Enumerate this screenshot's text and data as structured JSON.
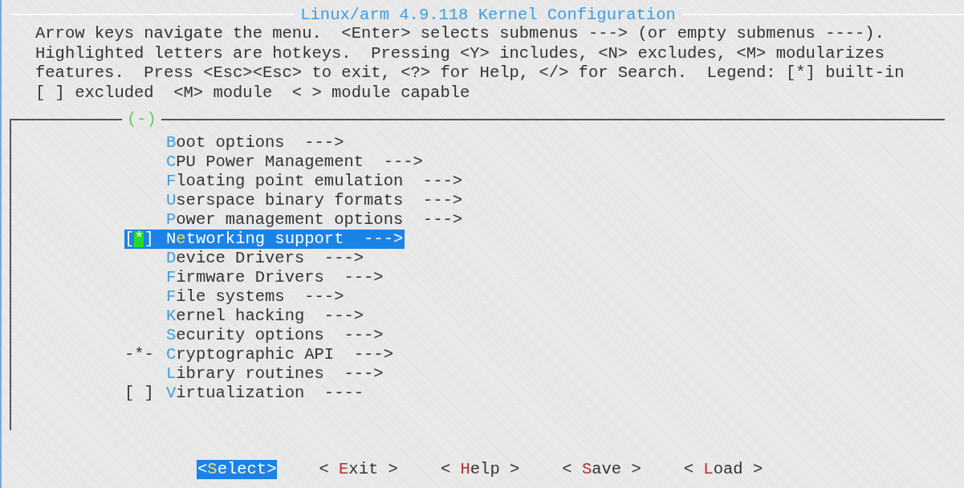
{
  "window": {
    "title": "Linux/arm 4.9.118 Kernel Configuration"
  },
  "help_lines": [
    "Arrow keys navigate the menu.  <Enter> selects submenus ---> (or empty submenus ----).",
    "Highlighted letters are hotkeys.  Pressing <Y> includes, <N> excludes, <M> modularizes",
    "features.  Press <Esc><Esc> to exit, <?> for Help, </> for Search.  Legend: [*] built-in",
    "[ ] excluded  <M> module  < > module capable"
  ],
  "menu": {
    "scroll_indicator": "(-)",
    "items": [
      {
        "hotkey": "B",
        "rest": "oot options",
        "suffix": "--->",
        "selected": false
      },
      {
        "hotkey": "C",
        "rest": "PU Power Management",
        "suffix": "--->",
        "selected": false
      },
      {
        "hotkey": "F",
        "rest": "loating point emulation",
        "suffix": "--->",
        "selected": false
      },
      {
        "hotkey": "U",
        "rest": "serspace binary formats",
        "suffix": "--->",
        "selected": false
      },
      {
        "hotkey": "P",
        "rest": "ower management options",
        "suffix": "--->",
        "selected": false
      },
      {
        "prefix": "[*]",
        "lead": "N",
        "hotkey": "e",
        "rest": "tworking support",
        "suffix": "--->",
        "selected": true
      },
      {
        "hotkey": "D",
        "rest": "evice Drivers",
        "suffix": "--->",
        "selected": false
      },
      {
        "hotkey": "F",
        "rest": "irmware Drivers",
        "suffix": "--->",
        "selected": false
      },
      {
        "hotkey": "F",
        "rest": "ile systems",
        "suffix": "--->",
        "selected": false
      },
      {
        "hotkey": "K",
        "rest": "ernel hacking",
        "suffix": "--->",
        "selected": false
      },
      {
        "hotkey": "S",
        "rest": "ecurity options",
        "suffix": "--->",
        "selected": false
      },
      {
        "prefix": "-*-",
        "hotkey": "C",
        "rest": "ryptographic API",
        "suffix": "--->",
        "selected": false
      },
      {
        "hotkey": "L",
        "rest": "ibrary routines",
        "suffix": "--->",
        "selected": false
      },
      {
        "prefix": "[ ]",
        "hotkey": "V",
        "rest": "irtualization",
        "suffix": "----",
        "selected": false
      }
    ]
  },
  "buttons": [
    {
      "open": "<",
      "hotkey": "S",
      "rest": "elect",
      "close": ">",
      "selected": true
    },
    {
      "open": "< ",
      "hotkey": "E",
      "rest": "xit",
      "close": " >",
      "selected": false
    },
    {
      "open": "< ",
      "hotkey": "H",
      "rest": "elp",
      "close": " >",
      "selected": false
    },
    {
      "open": "< ",
      "hotkey": "S",
      "rest": "ave",
      "close": " >",
      "selected": false
    },
    {
      "open": "< ",
      "hotkey": "L",
      "rest": "oad",
      "close": " >",
      "selected": false
    }
  ]
}
